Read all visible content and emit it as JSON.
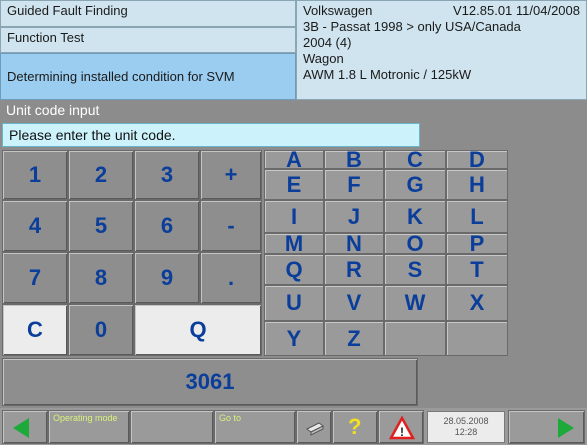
{
  "header": {
    "mode": "Guided Fault Finding",
    "function": "Function Test",
    "task": "Determining installed condition for SVM",
    "brand": "Volkswagen",
    "version": "V12.85.01 11/04/2008",
    "model": "3B - Passat 1998 > only USA/Canada",
    "year": "2004 (4)",
    "body": "Wagon",
    "engine": "AWM 1.8 L Motronic / 125kW"
  },
  "section_title": "Unit code input",
  "prompt": "Please enter the unit code.",
  "keypad": {
    "keys": [
      "1",
      "2",
      "3",
      "+",
      "4",
      "5",
      "6",
      "-",
      "7",
      "8",
      "9",
      ".",
      "C",
      "0",
      "Q"
    ]
  },
  "letters": [
    "A",
    "B",
    "C",
    "D",
    "E",
    "F",
    "G",
    "H",
    "I",
    "J",
    "K",
    "L",
    "M",
    "N",
    "O",
    "P",
    "Q",
    "R",
    "S",
    "T",
    "U",
    "V",
    "W",
    "X",
    "Y",
    "Z"
  ],
  "entered_code": "3061",
  "bottom": {
    "operating_mode_label": "Operating mode",
    "go_to_label": "Go to",
    "help_icon": "question-mark",
    "warning_icon": "warning-triangle",
    "print_icon": "printer",
    "date": "28.05.2008",
    "time": "12:28"
  },
  "colors": {
    "key_text": "#0a3e9a",
    "arrow": "#1eaa3a",
    "help": "#f0e020",
    "warning": "#e02020"
  }
}
